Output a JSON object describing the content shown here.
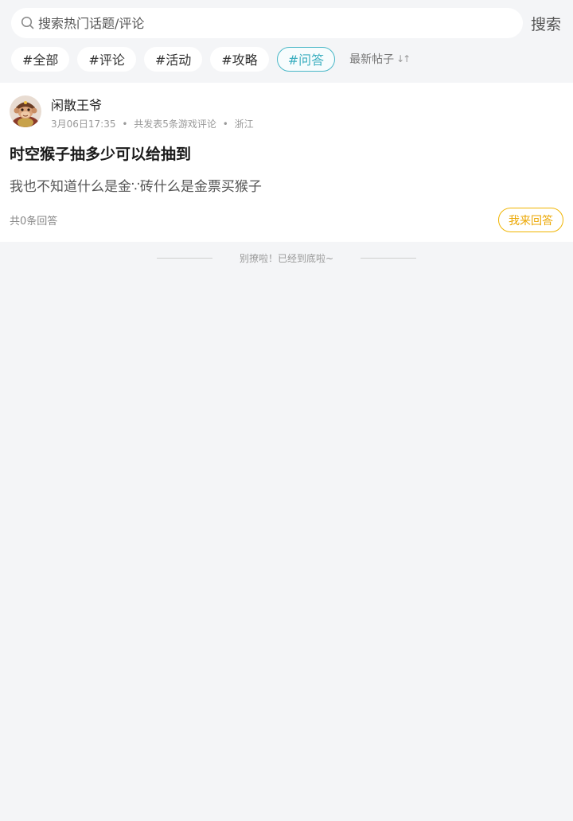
{
  "search": {
    "placeholder": "搜索热门话题/评论",
    "value": "",
    "button_label": "搜索"
  },
  "tags": [
    {
      "label": "#全部",
      "active": false
    },
    {
      "label": "#评论",
      "active": false
    },
    {
      "label": "#活动",
      "active": false
    },
    {
      "label": "#攻略",
      "active": false
    },
    {
      "label": "#问答",
      "active": true
    }
  ],
  "sort": {
    "label": "最新帖子",
    "icon": "sort-arrows-icon"
  },
  "post": {
    "author": "闲散王爷",
    "date": "3月06日17:35",
    "stats": "共发表5条游戏评论",
    "location": "浙江",
    "separator": "•",
    "title": "时空猴子抽多少可以给抽到",
    "body": "我也不知道什么是金∵砖什么是金票买猴子",
    "reply_count": "共0条回答",
    "answer_label": "我来回答"
  },
  "footer": {
    "end_text": "别撩啦！已经到底啦~"
  },
  "colors": {
    "accent_teal": "#49b7c7",
    "answer_orange": "#f0b400",
    "page_bg": "#f4f5f7"
  }
}
